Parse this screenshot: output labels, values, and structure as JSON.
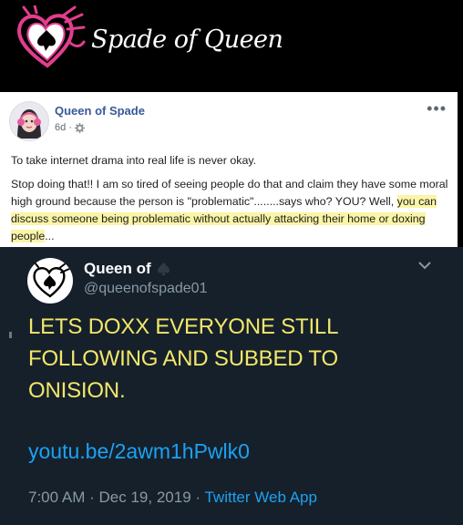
{
  "banner": {
    "brand_text": "Spade of Queen",
    "logo_icon": "heart-spade-logo-icon",
    "accent": "#e23d8e"
  },
  "facebook_post": {
    "author": "Queen of Spade",
    "age": "6d",
    "dot": "·",
    "privacy_icon": "gear-icon",
    "more_icon": "more-options-icon",
    "more_glyph": "•••",
    "paragraph_1": "To take internet drama into real life is never okay.",
    "paragraph_2_plain": "Stop doing that!! I am so tired of seeing people do that and claim they have some moral high ground because the person is \"problematic\"........says who? YOU? Well, ",
    "paragraph_2_highlight": "you can discuss someone being problematic without actually attacking their home or doxing people",
    "paragraph_2_end": "...",
    "highlight_color": "#fbf5a6"
  },
  "tweet": {
    "display_name": "Queen of",
    "name_icon": "spade-icon",
    "handle": "@queenofspade01",
    "chevron_icon": "chevron-down-icon",
    "body": "LETS DOXX EVERYONE STILL FOLLOWING AND SUBBED TO ONISION.",
    "link": "youtu.be/2awm1hPwlk0",
    "time": "7:00 AM",
    "sep": "·",
    "date": "Dec 19, 2019",
    "source": "Twitter Web App",
    "body_color": "#f3e76a",
    "background": "#15202b"
  }
}
